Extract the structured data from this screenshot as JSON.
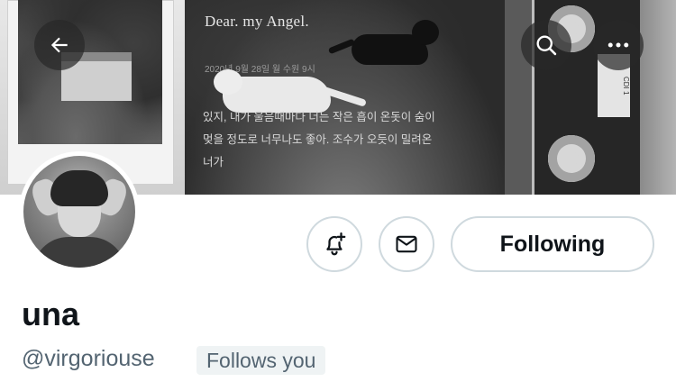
{
  "banner": {
    "title": "Dear. my Angel.",
    "date": "2020년 9월 28일 월 수원 9시",
    "poem_line1": "있지, 내가 울음때마다 너는 작은 흡이 온돗이 숨이",
    "poem_line2": "멎을 정도로 너무나도 좋아. 조수가 오듯이 밀려온",
    "poem_line3": "너가",
    "cassette_label": "CDI 1"
  },
  "nav": {
    "back_icon": "back-arrow-icon",
    "search_icon": "search-icon",
    "more_icon": "more-icon"
  },
  "actions": {
    "notify_icon": "bell-plus-icon",
    "message_icon": "envelope-icon",
    "following_label": "Following"
  },
  "profile": {
    "name": "una",
    "handle": "@virgoriouse",
    "follows_you": "Follows you"
  },
  "colors": {
    "text_primary": "#0f1419",
    "text_secondary": "#536471",
    "border": "#cfd9de",
    "badge_bg": "#eff3f4"
  }
}
